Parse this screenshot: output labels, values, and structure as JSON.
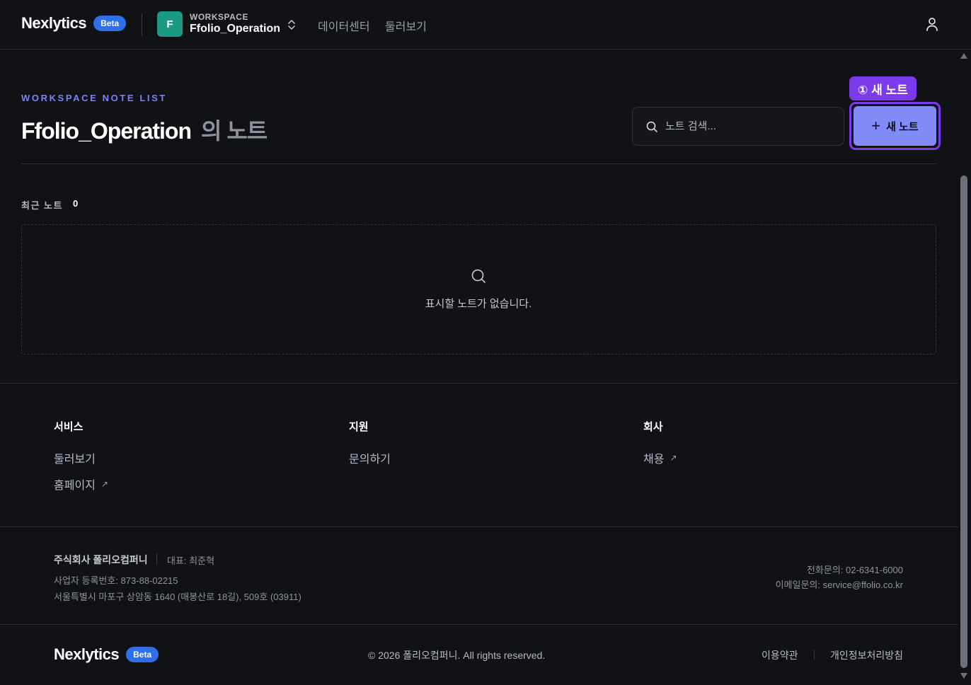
{
  "header": {
    "brand": "Nexlytics",
    "badge": "Beta",
    "workspace_kicker": "WORKSPACE",
    "workspace_initial": "F",
    "workspace_name": "Ffolio_Operation",
    "nav": [
      "데이터센터",
      "둘러보기"
    ],
    "icons": {
      "switch": "chevrons-up-down-icon",
      "user": "user-icon"
    },
    "colors": {
      "badge": "#2f6fe8",
      "workspace_avatar": "#1a9a84"
    }
  },
  "main": {
    "kicker": "WORKSPACE NOTE LIST",
    "title_workspace": "Ffolio_Operation",
    "title_suffix": "의 노트",
    "search": {
      "placeholder": "노트 검색...",
      "value": ""
    },
    "tooltip": "① 새 노트",
    "new_button": {
      "icon": "+",
      "label": "새 노트"
    },
    "recent_label": "최근 노트",
    "recent_count": "0",
    "empty_text": "표시할 노트가 없습니다.",
    "colors": {
      "accent": "#818cf8",
      "highlight": "#7c3aed",
      "kicker": "#7a82f5"
    }
  },
  "footer": {
    "columns": [
      {
        "title": "서비스",
        "links": [
          {
            "label": "둘러보기",
            "external": false
          },
          {
            "label": "홈페이지",
            "external": true
          }
        ]
      },
      {
        "title": "지원",
        "links": [
          {
            "label": "문의하기",
            "external": false
          }
        ]
      },
      {
        "title": "회사",
        "links": [
          {
            "label": "채용",
            "external": true
          }
        ]
      }
    ],
    "external_glyph": "↗",
    "company": "주식회사 폴리오컴퍼니",
    "ceo": "대표: 최준혁",
    "biz_number": "사업자 등록번호: 873-88-02215",
    "address": "서울특별시 마포구 상암동 1640 (매봉산로 18길), 509호 (03911)",
    "phone": "전화문의: 02-6341-6000",
    "email": "이메일문의: service@ffolio.co.kr",
    "brand": "Nexlytics",
    "badge": "Beta",
    "copyright": "© 2026 폴리오컴퍼니. All rights reserved.",
    "terms": "이용약관",
    "privacy": "개인정보처리방침"
  }
}
